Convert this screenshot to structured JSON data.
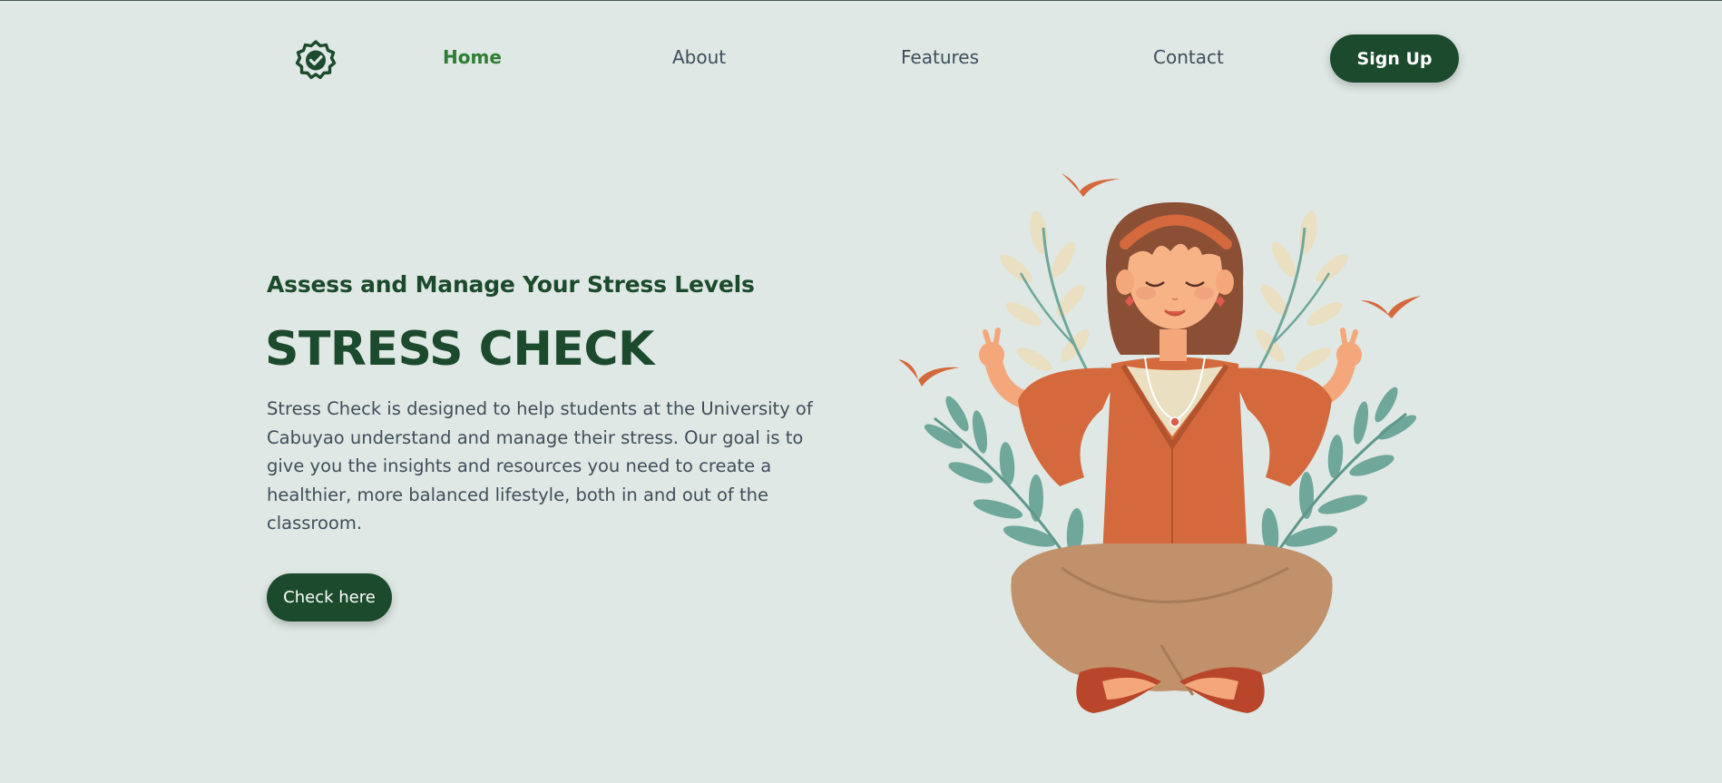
{
  "logo": {
    "icon": "badge-check-icon"
  },
  "nav": {
    "items": [
      {
        "label": "Home",
        "active": true
      },
      {
        "label": "About",
        "active": false
      },
      {
        "label": "Features",
        "active": false
      },
      {
        "label": "Contact",
        "active": false
      }
    ],
    "signup_label": "Sign Up"
  },
  "hero": {
    "subtitle": "Assess and Manage Your Stress Levels",
    "title": "STRESS CHECK",
    "description": "Stress Check is designed to help students at the University of Cabuyao understand and manage their stress. Our goal is to give you the insights and resources you need to create a healthier, more balanced lifestyle, both in and out of the classroom.",
    "cta_label": "Check here"
  },
  "illustration": {
    "icon": "meditating-woman-illustration"
  },
  "colors": {
    "background": "#dfe8e4",
    "primary": "#1b4a2c",
    "active_link": "#2e7d32",
    "text": "#3f4e5a",
    "accent_orange": "#d4693d"
  }
}
